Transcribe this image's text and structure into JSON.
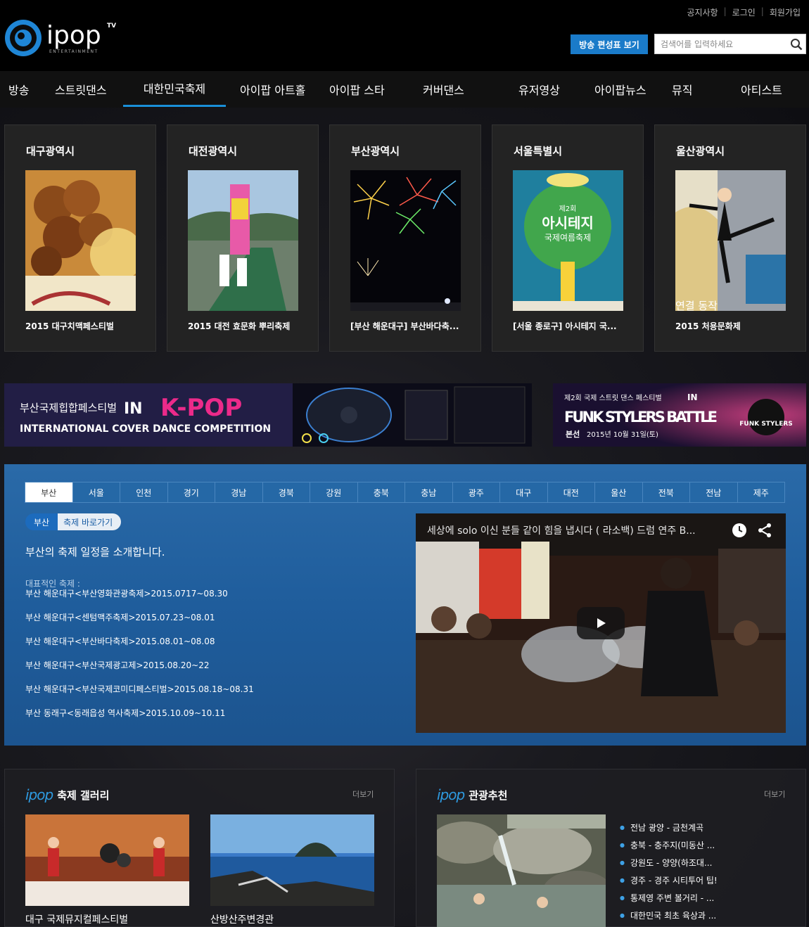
{
  "header": {
    "logo_text": "ipop",
    "logo_sub": "ENTERTAINMENT",
    "logo_tv": "TV",
    "top_links": [
      "공지사항",
      "로그인",
      "회원가입"
    ],
    "schedule_button": "방송 편성표 보기",
    "search_placeholder": "검색어를 입력하세요"
  },
  "nav": {
    "items": [
      "방송",
      "스트릿댄스",
      "대한민국축제",
      "아이팝 아트홀",
      "아이팝 스타",
      "커버댄스",
      "유저영상",
      "아이팝뉴스",
      "뮤직",
      "아티스트"
    ],
    "active": "대한민국축제"
  },
  "regions": [
    {
      "title": "대구광역시",
      "caption": "2015 대구치맥페스티벌"
    },
    {
      "title": "대전광역시",
      "caption": "2015 대전 효문화 뿌리축제"
    },
    {
      "title": "부산광역시",
      "caption": "[부산 해운대구] 부산바다축..."
    },
    {
      "title": "서울특별시",
      "caption": "[서울 종로구] 아시테지 국..."
    },
    {
      "title": "울산광역시",
      "caption": "2015 처용문화제",
      "overlay": "연결 동작"
    }
  ],
  "poster_text": {
    "line1": "제2회",
    "line2": "아시테지",
    "line3": "국제여름축제"
  },
  "banner1": {
    "line1": "부산국제힙합페스티벌",
    "in": "IN",
    "kpop": "K-POP",
    "line2": "INTERNATIONAL COVER DANCE COMPETITION"
  },
  "banner2": {
    "top": "제2회 국제 스트릿 댄스 페스티벌",
    "in": "IN",
    "title": "FUNK STYLERS BATTLE",
    "sub_label": "본선",
    "sub_date": "2015년 10월 31일(토)",
    "badge": "FUNK STYLERS"
  },
  "festival": {
    "tabs": [
      "부산",
      "서울",
      "인천",
      "경기",
      "경남",
      "경북",
      "강원",
      "충북",
      "충남",
      "광주",
      "대구",
      "대전",
      "울산",
      "전북",
      "전남",
      "제주"
    ],
    "active_tab": "부산",
    "pill_region": "부산",
    "pill_link": "축제 바로가기",
    "intro": "부산의 축제 일정을 소개합니다.",
    "list_label": "대표적인 축제 :",
    "items": [
      "부산 해운대구<부산영화관광축제>2015.0717~08.30",
      "부산 해운대구<센텀맥주축제>2015.07.23~08.01",
      "부산 해운대구<부산바다축제>2015.08.01~08.08",
      "부산 해운대구<부산국제광고제>2015.08.20~22",
      "부산 해운대구<부산국제코미디페스티벌>2015.08.18~08.31",
      "부산 동래구<동래읍성 역사축제>2015.10.09~10.11"
    ],
    "video_title": "세상에 solo 이신 분들 같이 힘을 냅시다 ( 라소백) 드럼 연주 B..."
  },
  "gallery": {
    "brand": "ipop",
    "title": "축제 갤러리",
    "more": "더보기",
    "items": [
      {
        "caption": "대구 국제뮤지컬페스티벌"
      },
      {
        "caption": "산방산주변경관"
      }
    ]
  },
  "tourism": {
    "brand": "ipop",
    "title": "관광추천",
    "more": "더보기",
    "items": [
      "전남 광양 - 금천계곡",
      "충북 - 충주지(미동산 ...",
      "강원도 - 양양(하조대...",
      "경주 - 경주 시티투어 팁!",
      "통제영 주변 볼거리 - ...",
      "대한민국 최초 육상과 ..."
    ]
  }
}
